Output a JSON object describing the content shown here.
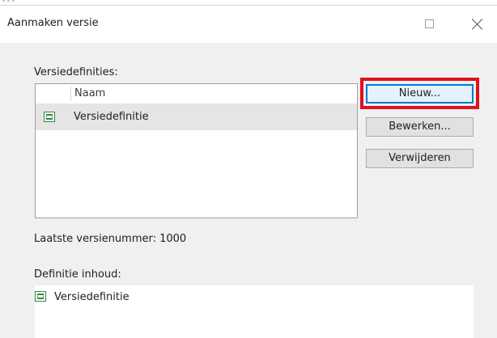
{
  "window": {
    "title": "Aanmaken versie"
  },
  "title_buttons": {
    "maximize_icon": "maximize-icon",
    "close_icon": "close-icon"
  },
  "definitions": {
    "label": "Versiedefinities:",
    "column_header": "Naam",
    "items": [
      {
        "name": "Versiedefinitie",
        "icon": "version-definition-icon",
        "selected": true
      }
    ]
  },
  "buttons": {
    "new": "Nieuw...",
    "edit": "Bewerken...",
    "delete": "Verwijderen"
  },
  "last_version": {
    "text": "Laatste versienummer: 1000"
  },
  "content": {
    "label": "Definitie inhoud:",
    "item": "Versiedefinitie",
    "icon": "version-definition-icon"
  },
  "colors": {
    "highlight_frame": "#e0101e",
    "icon_green": "#2e8b3e",
    "selected_row": "#e5e5e5",
    "default_button_border": "#0078d7"
  }
}
